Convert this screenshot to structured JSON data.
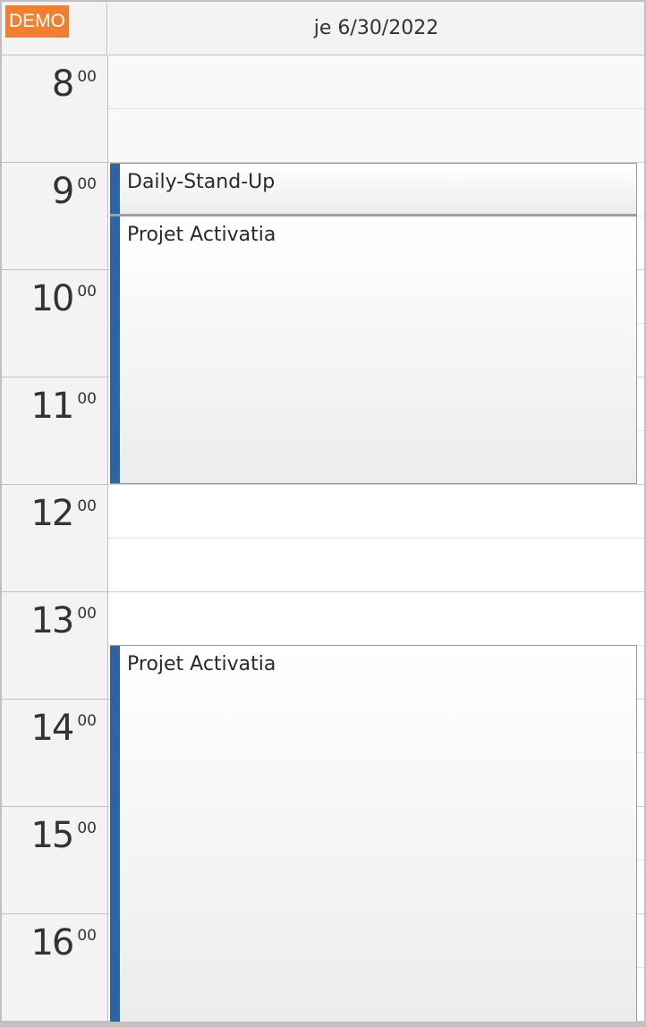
{
  "badge": {
    "label": "DEMO",
    "color": "#f07f30"
  },
  "header": {
    "day_label": "je 6/30/2022"
  },
  "time_axis": {
    "hours": [
      {
        "hour": "8",
        "minutes": "00"
      },
      {
        "hour": "9",
        "minutes": "00"
      },
      {
        "hour": "10",
        "minutes": "00"
      },
      {
        "hour": "11",
        "minutes": "00"
      },
      {
        "hour": "12",
        "minutes": "00"
      },
      {
        "hour": "13",
        "minutes": "00"
      },
      {
        "hour": "14",
        "minutes": "00"
      },
      {
        "hour": "15",
        "minutes": "00"
      },
      {
        "hour": "16",
        "minutes": "00"
      }
    ]
  },
  "events": [
    {
      "title": "Daily-Stand-Up",
      "start": "9:00",
      "end": "9:30",
      "bar_color": "#2e64a4"
    },
    {
      "title": "Projet Activatia",
      "start": "9:30",
      "end": "12:00",
      "bar_color": "#2e64a4"
    },
    {
      "title": "Projet Activatia",
      "start": "13:30",
      "end": "17:00",
      "bar_color": "#2e64a4"
    }
  ]
}
